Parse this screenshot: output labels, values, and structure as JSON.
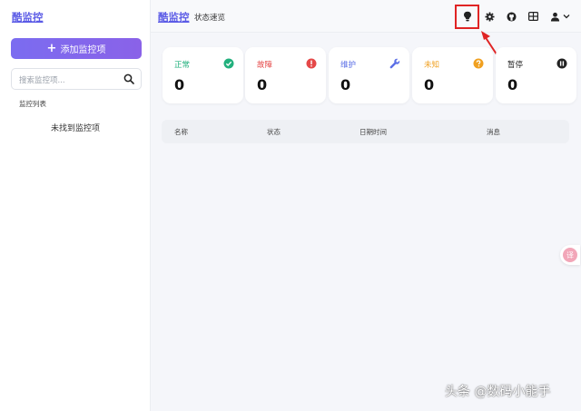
{
  "sidebar": {
    "brand": "酷监控",
    "add_button_label": "添加监控项",
    "search_placeholder": "搜索监控项...",
    "list_title": "监控列表",
    "empty_message": "未找到监控项"
  },
  "header": {
    "brand": "酷监控",
    "subtitle": "状态速览",
    "icons": [
      "lightbulb-icon",
      "gear-icon",
      "github-icon",
      "grid-icon",
      "user-icon",
      "chevron-down-icon"
    ]
  },
  "cards": [
    {
      "label": "正常",
      "value": "0",
      "color": "#22b07d",
      "icon": "check-circle-icon"
    },
    {
      "label": "故障",
      "value": "0",
      "color": "#e54848",
      "icon": "exclamation-circle-icon"
    },
    {
      "label": "维护",
      "value": "0",
      "color": "#5b6fe6",
      "icon": "wrench-icon"
    },
    {
      "label": "未知",
      "value": "0",
      "color": "#f0a020",
      "icon": "question-circle-icon"
    },
    {
      "label": "暂停",
      "value": "0",
      "color": "#222222",
      "icon": "pause-circle-icon"
    }
  ],
  "table": {
    "columns": [
      "名称",
      "状态",
      "日期时间",
      "消息"
    ]
  },
  "colors": {
    "accent": "#5b5be6",
    "highlight": "#e02424"
  },
  "float_button": {
    "label": "译"
  },
  "watermark": "头条 @数码小能手"
}
